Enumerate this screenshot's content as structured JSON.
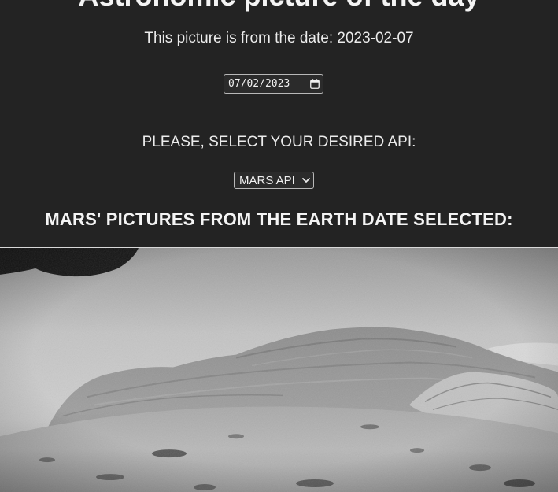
{
  "header": {
    "title": "Astronomic picture of the day",
    "date_line": "This picture is from the date: 2023-02-07"
  },
  "date_picker": {
    "value": "07/02/2023",
    "icon": "calendar-icon"
  },
  "api_selector": {
    "label": "PLEASE, SELECT YOUR DESIRED API:",
    "selected": "MARS API",
    "icon": "chevron-down-icon"
  },
  "gallery": {
    "heading": "MARS' PICTURES FROM THE EARTH DATE SELECTED:"
  },
  "colors": {
    "background": "#232323",
    "text": "#f2f2f2"
  }
}
